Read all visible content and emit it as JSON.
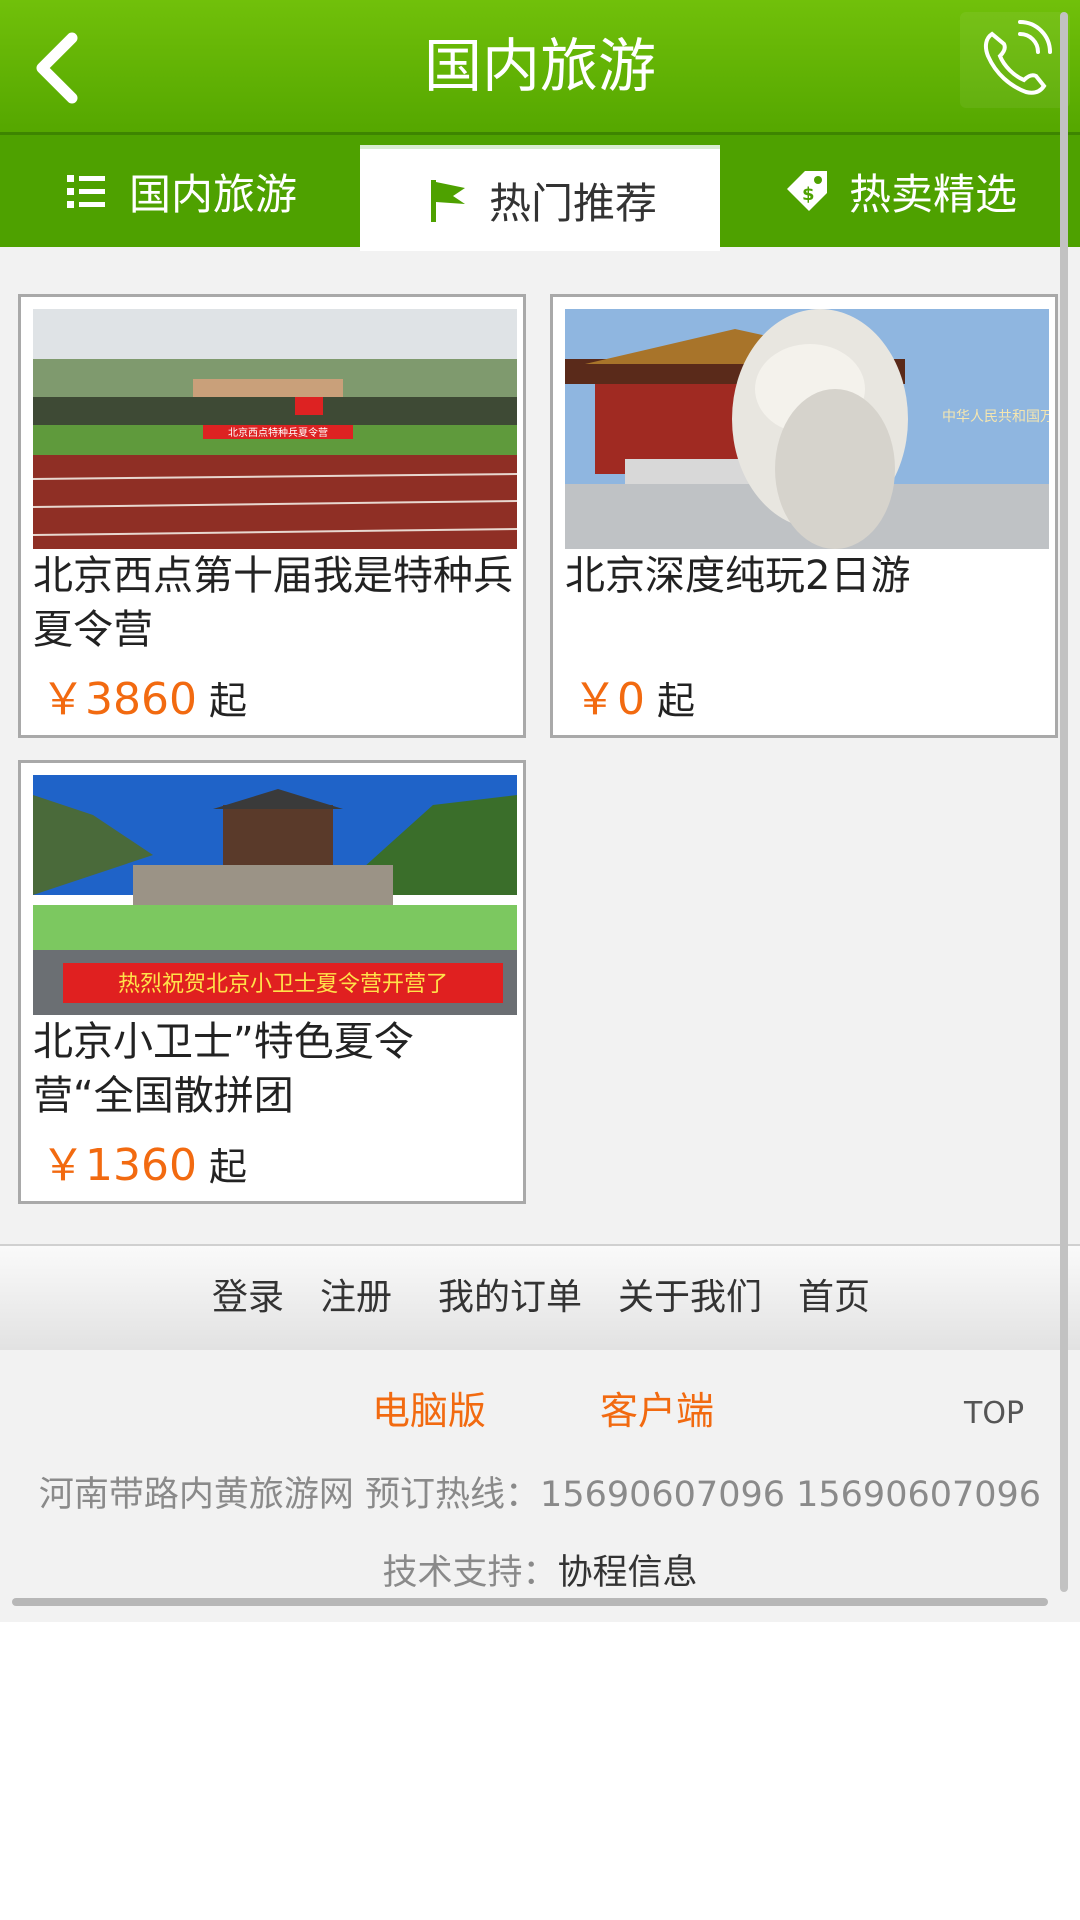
{
  "header": {
    "title": "国内旅游",
    "back_icon": "chevron-left-icon",
    "phone_icon": "phone-icon"
  },
  "tabs": [
    {
      "label": "国内旅游",
      "icon": "list-icon",
      "active": false
    },
    {
      "label": "热门推荐",
      "icon": "flag-icon",
      "active": true
    },
    {
      "label": "热卖精选",
      "icon": "price-tag-icon",
      "active": false
    }
  ],
  "products": [
    {
      "title": "北京西点第十届我是特种兵夏令营",
      "price": "￥3860",
      "suffix": "起"
    },
    {
      "title": "北京深度纯玩2日游",
      "price": "￥0",
      "suffix": "起"
    },
    {
      "title": "北京小卫士”特色夏令营“全国散拼团",
      "price": "￥1360",
      "suffix": "起"
    }
  ],
  "image_texts": {
    "banner_xidian": "北京西点特种兵夏令营",
    "banner_weishi": "热烈祝贺北京小卫士夏令营开营了",
    "sign_tiananmen": "中华人民共和国万岁"
  },
  "footer_nav": [
    "登录",
    "注册",
    "我的订单",
    "关于我们",
    "首页"
  ],
  "footer": {
    "pc_label": "电脑版",
    "client_label": "客户端",
    "top_label": "TOP",
    "info": "河南带路内黄旅游网  预订热线：15690607096  15690607096",
    "support_label": "技术支持：",
    "support_name": "协程信息"
  },
  "colors": {
    "brand_green": "#5ab300",
    "price_orange": "#f26a10",
    "page_bg": "#f2f2f2"
  }
}
